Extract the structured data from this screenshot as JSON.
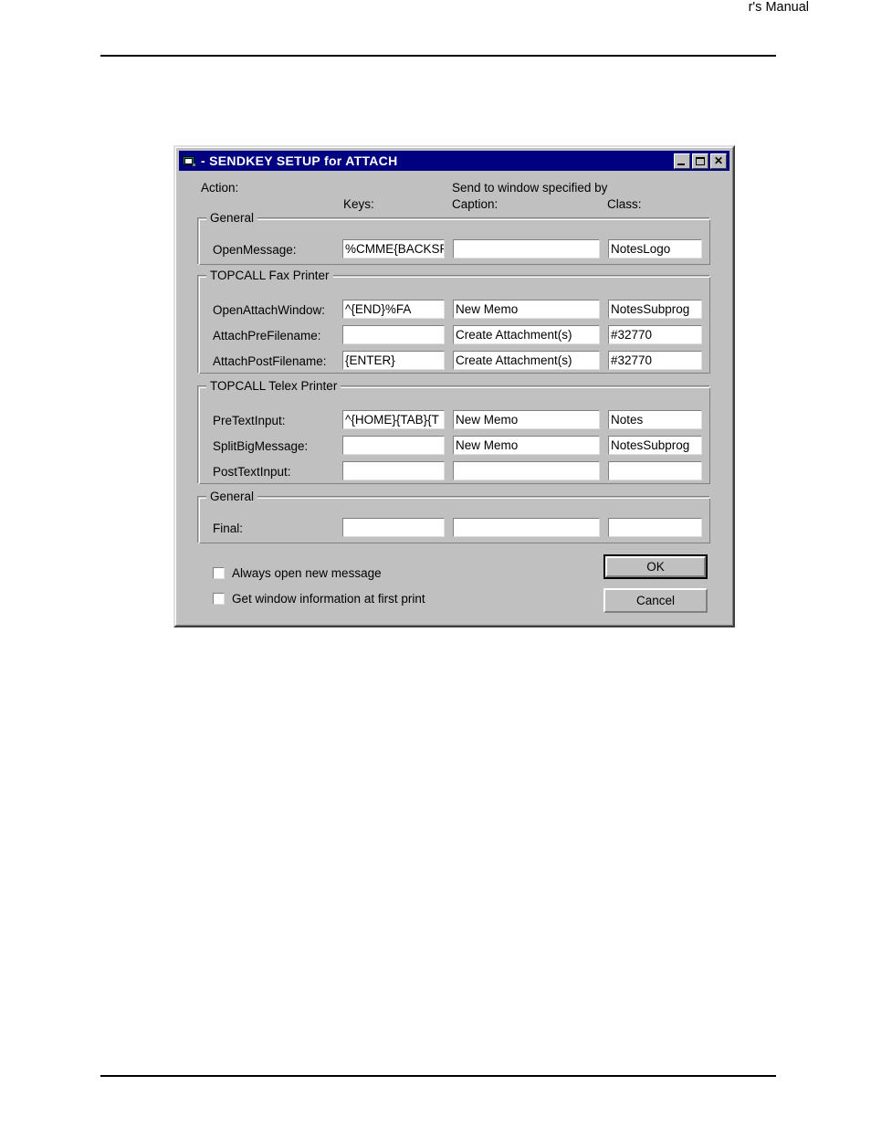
{
  "page": {
    "header_text": "r's Manual"
  },
  "dialog": {
    "title": "- SENDKEY SETUP for ATTACH",
    "icon": "window-stack-icon",
    "window_buttons": {
      "minimize": "_",
      "maximize": "□",
      "close": "✕"
    },
    "headers": {
      "action": "Action:",
      "send_to": "Send to window specified by",
      "keys": "Keys:",
      "caption": "Caption:",
      "class": "Class:"
    },
    "groups": [
      {
        "title": "General",
        "rows": [
          {
            "label": "OpenMessage:",
            "keys": "%CMME{BACKSP",
            "caption": "",
            "class": "NotesLogo"
          }
        ]
      },
      {
        "title": "TOPCALL Fax Printer",
        "rows": [
          {
            "label": "OpenAttachWindow:",
            "keys": "^{END}%FA",
            "caption": "New Memo",
            "class": "NotesSubprog"
          },
          {
            "label": "AttachPreFilename:",
            "keys": "",
            "caption": "Create Attachment(s)",
            "class": "#32770"
          },
          {
            "label": "AttachPostFilename:",
            "keys": "{ENTER}",
            "caption": "Create Attachment(s)",
            "class": "#32770"
          }
        ]
      },
      {
        "title": "TOPCALL Telex Printer",
        "rows": [
          {
            "label": "PreTextInput:",
            "keys": "^{HOME}{TAB}{T",
            "caption": "New Memo",
            "class": "Notes"
          },
          {
            "label": "SplitBigMessage:",
            "keys": "",
            "caption": "New Memo",
            "class": "NotesSubprog"
          },
          {
            "label": "PostTextInput:",
            "keys": "",
            "caption": "",
            "class": ""
          }
        ]
      },
      {
        "title": "General",
        "rows": [
          {
            "label": "Final:",
            "keys": "",
            "caption": "",
            "class": ""
          }
        ]
      }
    ],
    "checkboxes": [
      {
        "label": "Always open new message",
        "checked": false
      },
      {
        "label": "Get window information at first print",
        "checked": false
      }
    ],
    "buttons": {
      "ok": "OK",
      "cancel": "Cancel"
    },
    "colors": {
      "titlebar": "#000080",
      "face": "#c0c0c0",
      "field": "#ffffff"
    }
  }
}
